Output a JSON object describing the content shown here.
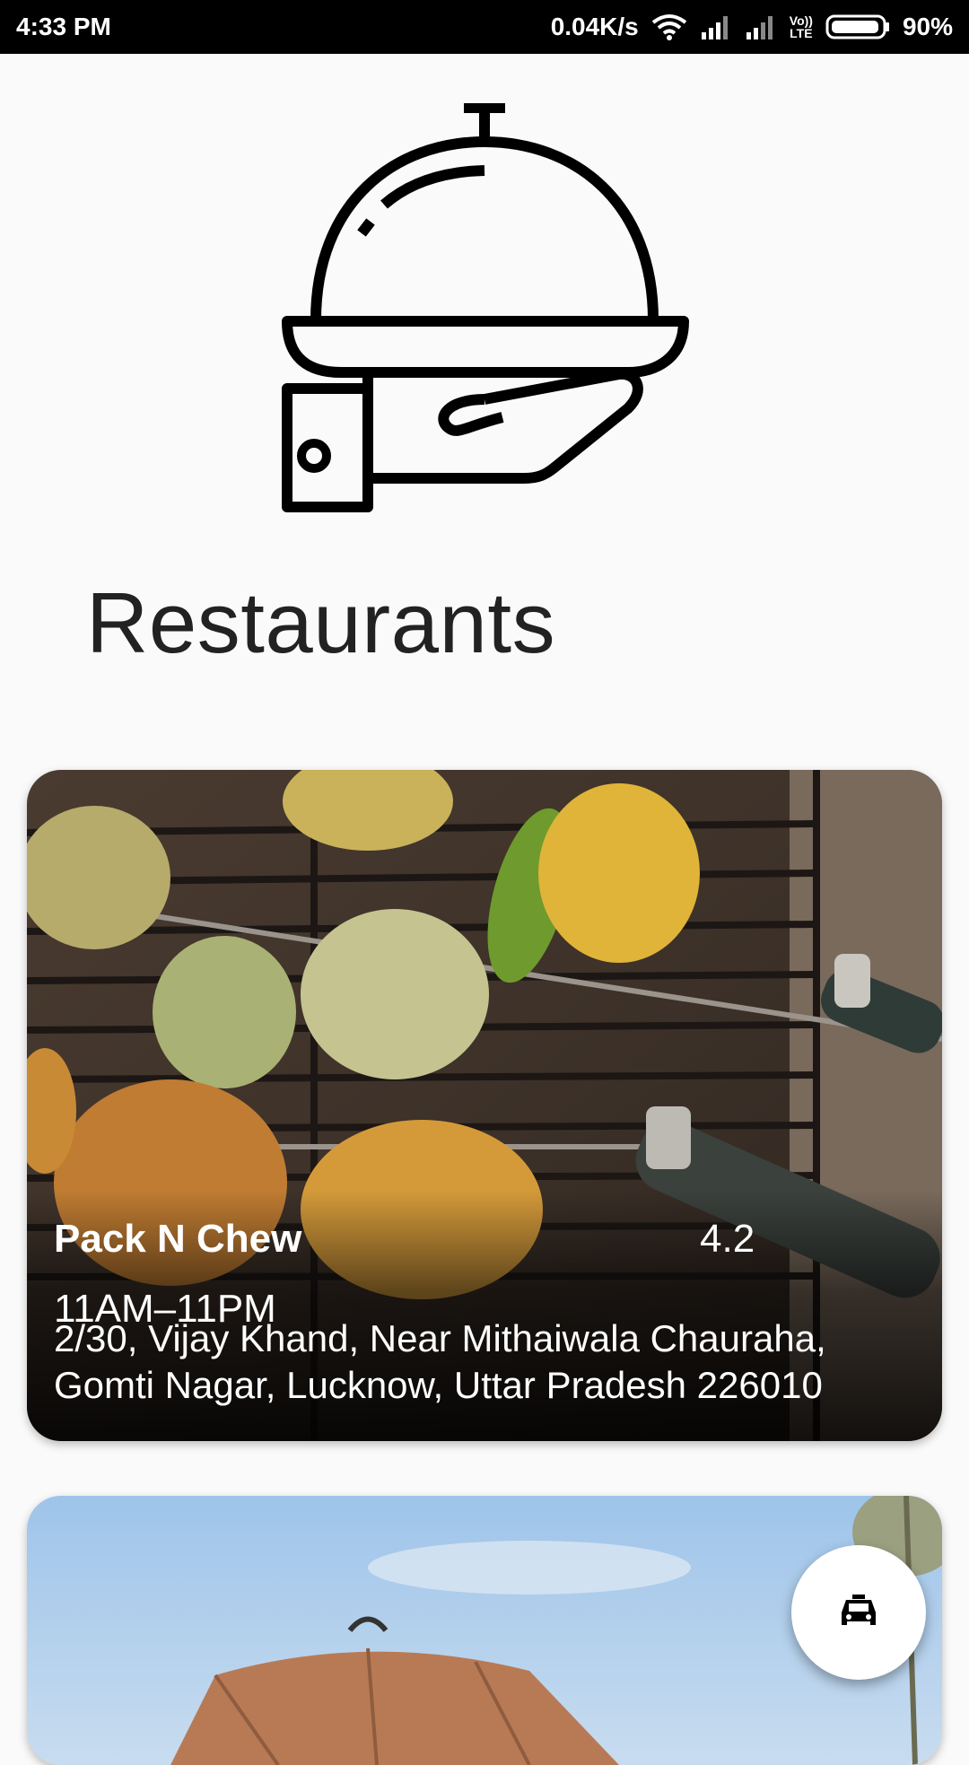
{
  "status_bar": {
    "time": "4:33 PM",
    "network_speed": "0.04K/s",
    "lte_label_top": "Vo))",
    "lte_label_bottom": "LTE",
    "battery": "90%",
    "icons": [
      "wifi-icon",
      "signal-icon",
      "signal-icon",
      "volte-icon",
      "battery-icon"
    ]
  },
  "header": {
    "logo_icon": "food-cloche-on-hand-icon",
    "title": "Restaurants"
  },
  "restaurants": [
    {
      "name": "Pack N Chew",
      "rating": "4.2",
      "hours": "11AM–11PM",
      "address": "2/30, Vijay Khand, Near Mithaiwala Chauraha, Gomti Nagar, Lucknow, Uttar Pradesh 226010",
      "image": "grilled-skewers-photo"
    },
    {
      "image": "outdoor-umbrella-photo"
    }
  ],
  "fab": {
    "icon": "taxi-icon"
  }
}
